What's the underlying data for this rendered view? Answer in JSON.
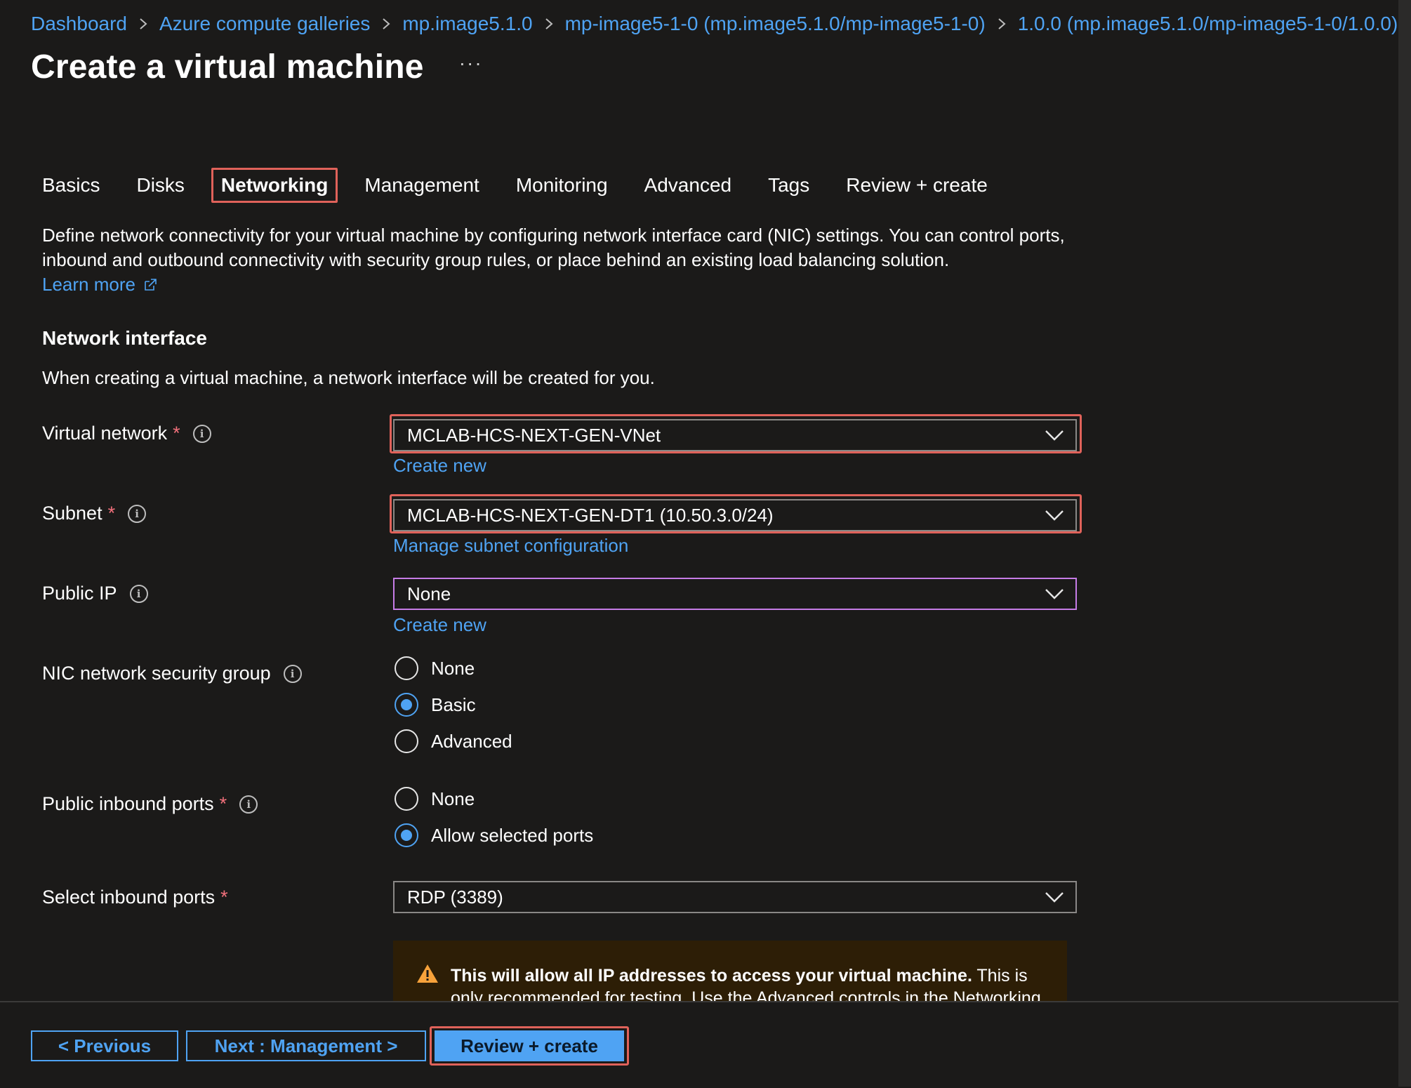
{
  "breadcrumb": [
    "Dashboard",
    "Azure compute galleries",
    "mp.image5.1.0",
    "mp-image5-1-0 (mp.image5.1.0/mp-image5-1-0)",
    "1.0.0 (mp.image5.1.0/mp-image5-1-0/1.0.0)"
  ],
  "page": {
    "title": "Create a virtual machine",
    "more": "···"
  },
  "tabs": [
    "Basics",
    "Disks",
    "Networking",
    "Management",
    "Monitoring",
    "Advanced",
    "Tags",
    "Review + create"
  ],
  "active_tab": "Networking",
  "intro": {
    "description": "Define network connectivity for your virtual machine by configuring network interface card (NIC) settings. You can control ports, inbound and outbound connectivity with security group rules, or place behind an existing load balancing solution.",
    "learn_more": "Learn more"
  },
  "network_interface": {
    "title": "Network interface",
    "subtitle": "When creating a virtual machine, a network interface will be created for you."
  },
  "form": {
    "virtual_network": {
      "label": "Virtual network",
      "required": "*",
      "value": "MCLAB-HCS-NEXT-GEN-VNet",
      "link": "Create new"
    },
    "subnet": {
      "label": "Subnet",
      "required": "*",
      "value": "MCLAB-HCS-NEXT-GEN-DT1 (10.50.3.0/24)",
      "link": "Manage subnet configuration"
    },
    "public_ip": {
      "label": "Public IP",
      "value": "None",
      "link": "Create new"
    },
    "nic_nsg": {
      "label": "NIC network security group",
      "options": [
        "None",
        "Basic",
        "Advanced"
      ],
      "selected": "Basic"
    },
    "public_inbound_ports": {
      "label": "Public inbound ports",
      "required": "*",
      "options": [
        "None",
        "Allow selected ports"
      ],
      "selected": "Allow selected ports"
    },
    "select_inbound_ports": {
      "label": "Select inbound ports",
      "required": "*",
      "value": "RDP (3389)"
    }
  },
  "warning": {
    "bold": "This will allow all IP addresses to access your virtual machine.",
    "text": " This is only recommended for testing.  Use the Advanced controls in the Networking tab to"
  },
  "footer": {
    "previous": "< Previous",
    "next": "Next : Management >",
    "review": "Review + create"
  },
  "colors": {
    "background": "#1b1a19",
    "link": "#4fa3f3",
    "highlight": "#e0625a",
    "required": "#f1707b",
    "focus": "#c67ce6",
    "warning_bg": "#2d1e06",
    "warning_icon": "#f7a23b"
  },
  "icons": {
    "breadcrumb_separator": "chevron-right-icon",
    "dropdown": "chevron-down-icon",
    "info": "info-icon",
    "external_link": "external-link-icon",
    "warning": "warning-icon"
  }
}
